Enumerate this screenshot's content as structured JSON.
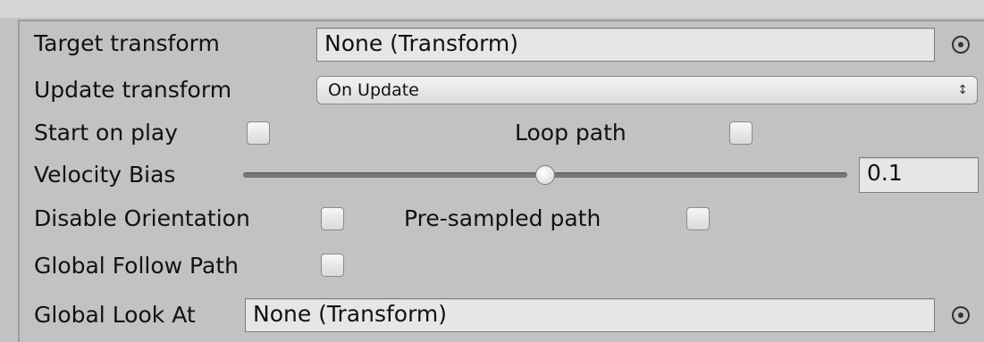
{
  "target_transform": {
    "label": "Target transform",
    "value": "None (Transform)",
    "icon": "object-picker-icon"
  },
  "update_transform": {
    "label": "Update transform",
    "value": "On Update",
    "icon": "dropdown-arrows-icon"
  },
  "start_on_play": {
    "label": "Start on play",
    "checked": false
  },
  "loop_path": {
    "label": "Loop path",
    "checked": false
  },
  "velocity_bias": {
    "label": "Velocity Bias",
    "value": "0.1",
    "slider_fraction": 0.5
  },
  "disable_orientation": {
    "label": "Disable Orientation",
    "checked": false
  },
  "pre_sampled_path": {
    "label": "Pre-sampled path",
    "checked": false
  },
  "global_follow_path": {
    "label": "Global Follow Path",
    "checked": false
  },
  "global_look_at": {
    "label": "Global Look At",
    "value": "None (Transform)",
    "icon": "object-picker-icon"
  }
}
